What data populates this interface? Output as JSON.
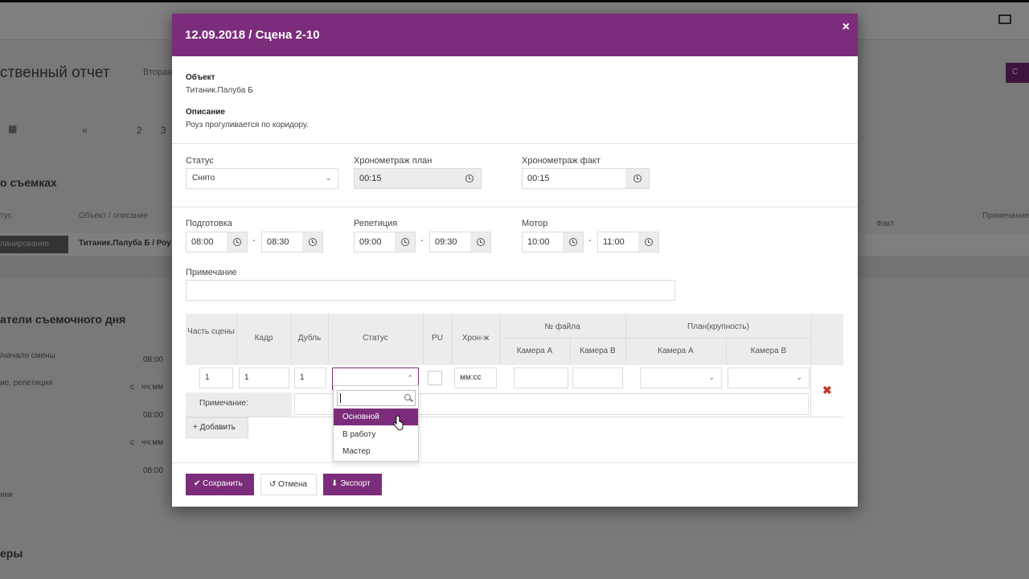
{
  "background": {
    "title_fragment": "ственный отчет",
    "subtitle_fragment": "Вторая",
    "pages": [
      "«",
      "2",
      "3"
    ],
    "section1": "о съемках",
    "col_status": "тус",
    "col_object": "Объект / описание",
    "col_fact": "Факт",
    "col_note": "Примечание",
    "row_badge": "ланирование",
    "row_text": "Титаник.Палуба Б / Роу",
    "section2": "атели съемочного дня",
    "label1": "/начало смены",
    "label2": "ие, репетиция",
    "label3": "ики",
    "time1": "08:00",
    "time2": "08:00",
    "time3": "08:00",
    "prefix": "с",
    "placeholder_time": "чч:мм",
    "section3": "еры",
    "btn_fragment": "С"
  },
  "modal": {
    "title": "12.09.2018 / Сцена 2-10",
    "close": "×",
    "object_label": "Объект",
    "object_value": "Титаник.Палуба Б",
    "description_label": "Описание",
    "description_value": "Роуз прогуливается по коридору.",
    "status_label": "Статус",
    "status_value": "Снято",
    "plan_label": "Хронометраж план",
    "plan_value": "00:15",
    "fact_label": "Хронометраж факт",
    "fact_value": "00:15",
    "prep_label": "Подготовка",
    "prep_from": "08:00",
    "prep_to": "08:30",
    "rehearsal_label": "Репетиция",
    "rehearsal_from": "09:00",
    "rehearsal_to": "09:30",
    "motor_label": "Мотор",
    "motor_from": "10:00",
    "motor_to": "11:00",
    "dash": "-",
    "note_label": "Примечание"
  },
  "table": {
    "headers": {
      "part": "Часть сцены",
      "frame": "Кадр",
      "take": "Дубль",
      "status": "Статус",
      "pu": "PU",
      "chron": "Хрон-ж",
      "file_no": "№ файла",
      "plan": "План(крупность)",
      "cam_a": "Камера А",
      "cam_b": "Камера В",
      "plan_cam_a": "Камера А",
      "plan_cam_b": "Камера В"
    },
    "row": {
      "part": "1",
      "frame": "1",
      "take": "1",
      "chron_placeholder": "мм:сс"
    },
    "note_label": "Примечание:",
    "delete": "✖",
    "add_button": "+ Добавить"
  },
  "dropdown": {
    "options": [
      "Основной",
      "В работу",
      "Мастер"
    ],
    "highlighted": "Основной"
  },
  "footer": {
    "save": "✔ Сохранить",
    "cancel": "↺ Отмена",
    "export": "⬇ Экспорт"
  },
  "colors": {
    "accent": "#7b2d7b",
    "danger": "#c0392b"
  }
}
